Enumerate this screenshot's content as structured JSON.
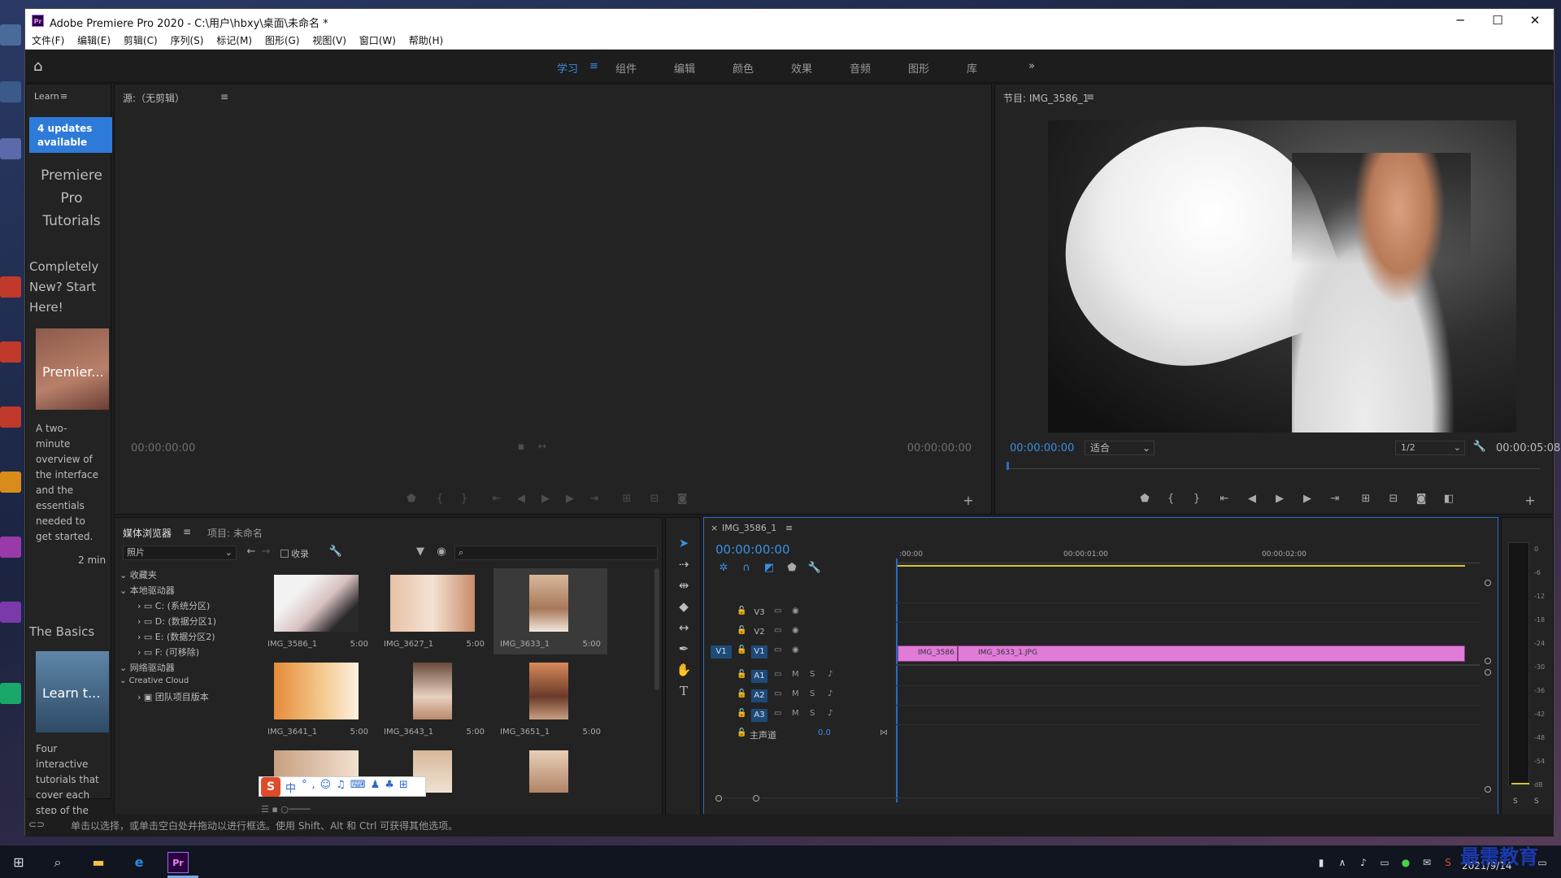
{
  "window": {
    "app_badge": "Pr",
    "title": "Adobe Premiere Pro 2020 - C:\\用户\\hbxy\\桌面\\未命名 *",
    "minimize": "─",
    "maximize": "☐",
    "close": "✕"
  },
  "menu": [
    "文件(F)",
    "编辑(E)",
    "剪辑(C)",
    "序列(S)",
    "标记(M)",
    "图形(G)",
    "视图(V)",
    "窗口(W)",
    "帮助(H)"
  ],
  "workspaces": {
    "tabs": [
      "学习",
      "组件",
      "编辑",
      "颜色",
      "效果",
      "音频",
      "图形",
      "库"
    ],
    "active": "学习",
    "more": "»"
  },
  "learn": {
    "title": "Learn",
    "updates_line1": "4 updates",
    "updates_line2": "available",
    "heading": "Premiere\nPro\nTutorials",
    "card1_heading": "Completely\nNew? Start\nHere!",
    "card1_thumb": "Premier...",
    "card1_desc": "A two-\nminute\noverview of\nthe interface\nand the\nessentials\nneeded to\nget started.",
    "card1_time": "2 min",
    "card2_heading": "The Basics",
    "card2_thumb": "Learn t...",
    "card2_desc": "Four\ninteractive\ntutorials that\ncover each\nstep of the"
  },
  "source": {
    "title": "源:（无剪辑）",
    "tc_left": "00:00:00:00",
    "tc_right": "00:00:00:00"
  },
  "program": {
    "title": "节目: IMG_3586_1",
    "tc_current": "00:00:00:00",
    "fit": "适合",
    "quality": "1/2",
    "tc_duration": "00:00:05:08"
  },
  "media_browser": {
    "tab_media": "媒体浏览器",
    "tab_project": "项目: 未命名",
    "filter": "照片",
    "favorites_checkbox": "收录",
    "tree": {
      "favorites": "收藏夹",
      "local": "本地驱动器",
      "drives": [
        "C: (系统分区)",
        "D: (数据分区1)",
        "E: (数据分区2)",
        "F: (可移除)"
      ],
      "network": "网络驱动器",
      "cc": "Creative Cloud",
      "team": "团队项目版本"
    },
    "items": [
      {
        "name": "IMG_3586_1",
        "dur": "5:00"
      },
      {
        "name": "IMG_3627_1",
        "dur": "5:00"
      },
      {
        "name": "IMG_3633_1",
        "dur": "5:00"
      },
      {
        "name": "IMG_3641_1",
        "dur": "5:00"
      },
      {
        "name": "IMG_3643_1",
        "dur": "5:00"
      },
      {
        "name": "IMG_3651_1",
        "dur": "5:00"
      }
    ]
  },
  "timeline": {
    "tab": "IMG_3586_1",
    "tc": "00:00:00:00",
    "ruler": [
      ":00:00",
      "00:00:01:00",
      "00:00:02:00"
    ],
    "video_tracks": [
      "V3",
      "V2",
      "V1"
    ],
    "audio_tracks": [
      "A1",
      "A2",
      "A3"
    ],
    "source_patch": "V1",
    "master": "主声道",
    "master_value": "0.0",
    "clips": [
      {
        "name": "IMG_3586",
        "color": "#e07bd8"
      },
      {
        "name": "IMG_3633_1.JPG",
        "color": "#e07bd8"
      }
    ]
  },
  "meter": {
    "scale": [
      "0",
      "-6",
      "-12",
      "-18",
      "-24",
      "-30",
      "-36",
      "-42",
      "-48",
      "-54",
      "dB"
    ],
    "solo_left": "S",
    "solo_right": "S"
  },
  "status": {
    "text": "单击以选择，或单击空白处并拖动以进行框选。使用 Shift、Alt 和 Ctrl 可获得其他选项。"
  },
  "taskbar": {
    "date": "2021/9/14",
    "watermark": "最需教育"
  },
  "ime": {
    "label": "中"
  },
  "colors": {
    "accent": "#2d7ad9",
    "timecode": "#3a8fe0",
    "clip": "#e07bd8",
    "playhead": "#2a6ac8"
  }
}
